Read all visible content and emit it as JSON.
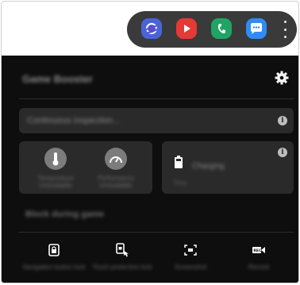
{
  "app_tray": {
    "apps": [
      {
        "icon": "samsung-internet-icon",
        "color": "#4a64d8"
      },
      {
        "icon": "youtube-icon",
        "color": "#e53935"
      },
      {
        "icon": "phone-icon",
        "color": "#1fa463"
      },
      {
        "icon": "messages-icon",
        "color": "#2f8cf6"
      }
    ],
    "more_icon": "more-vertical-icon"
  },
  "game_booster": {
    "title": "Game Booster",
    "settings_icon": "gear-icon",
    "monitor_bar": {
      "text": "Continuous inspection...",
      "icon": "info-icon"
    },
    "stats_card": {
      "items": [
        {
          "icon": "thermometer-icon",
          "label": "Temperature Unavailable"
        },
        {
          "icon": "speedometer-icon",
          "label": "Performance Unavailable"
        }
      ]
    },
    "battery_card": {
      "icon": "battery-icon",
      "text": "Charging",
      "sub": "Time",
      "info_icon": "info-icon"
    },
    "section_title": "Block during game",
    "tools": [
      {
        "icon": "lock-icon",
        "label": "Navigation button lock"
      },
      {
        "icon": "touch-lock-icon",
        "label": "Touch protection lock"
      },
      {
        "icon": "screenshot-icon",
        "label": "Screenshot"
      },
      {
        "icon": "record-icon",
        "label": "Record"
      }
    ]
  }
}
